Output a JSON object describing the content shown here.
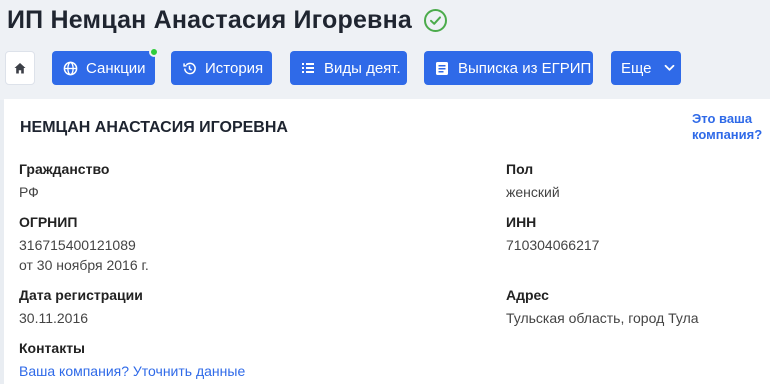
{
  "header": {
    "title": "ИП Немцан Анастасия Игоревна"
  },
  "toolbar": {
    "sanctions_label": "Санкции",
    "history_label": "История",
    "activities_label": "Виды деят.",
    "extract_label": "Выписка из ЕГРИП",
    "more_label": "Еще"
  },
  "card": {
    "company_name": "НЕМЦАН АНАСТАСИЯ ИГОРЕВНА",
    "your_company_line1": "Это ваша",
    "your_company_line2": "компания?",
    "citizenship_label": "Гражданство",
    "citizenship_value": "РФ",
    "gender_label": "Пол",
    "gender_value": "женский",
    "ogrnip_label": "ОГРНИП",
    "ogrnip_value": "316715400121089",
    "ogrnip_date": "от 30 ноября 2016 г.",
    "inn_label": "ИНН",
    "inn_value": "710304066217",
    "reg_date_label": "Дата регистрации",
    "reg_date_value": "30.11.2016",
    "address_label": "Адрес",
    "address_value": "Тульская область, город Тула",
    "contacts_label": "Контакты",
    "contacts_link": "Ваша компания? Уточнить данные"
  },
  "colors": {
    "accent": "#2f6ae8",
    "verified": "#4bab4b",
    "notification_dot": "#2fcc3b"
  },
  "icons": [
    "check-circle-icon",
    "home-icon",
    "globe-icon",
    "history-icon",
    "list-icon",
    "document-icon",
    "chevron-down-icon"
  ]
}
